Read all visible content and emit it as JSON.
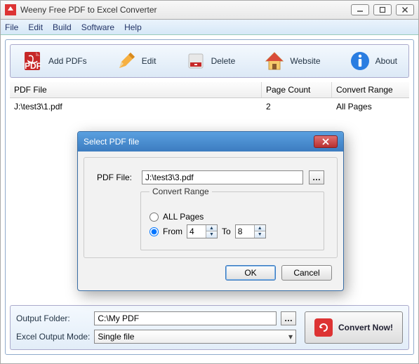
{
  "window": {
    "title": "Weeny Free PDF to Excel Converter"
  },
  "menu": {
    "file": "File",
    "edit": "Edit",
    "build": "Build",
    "software": "Software",
    "help": "Help"
  },
  "toolbar": {
    "add": "Add PDFs",
    "edit": "Edit",
    "delete": "Delete",
    "website": "Website",
    "about": "About"
  },
  "table": {
    "headers": {
      "file": "PDF File",
      "page": "Page Count",
      "range": "Convert Range"
    },
    "rows": [
      {
        "file": "J:\\test3\\1.pdf",
        "page": "2",
        "range": "All Pages"
      }
    ]
  },
  "bottom": {
    "output_label": "Output Folder:",
    "output_value": "C:\\My PDF",
    "mode_label": "Excel Output Mode:",
    "mode_value": "Single file",
    "convert": "Convert Now!"
  },
  "modal": {
    "title": "Select PDF file",
    "file_label": "PDF File:",
    "file_value": "J:\\test3\\3.pdf",
    "fieldset_title": "Convert Range",
    "all_label": "ALL Pages",
    "from_label": "From",
    "to_label": "To",
    "from_value": "4",
    "to_value": "8",
    "ok": "OK",
    "cancel": "Cancel"
  }
}
